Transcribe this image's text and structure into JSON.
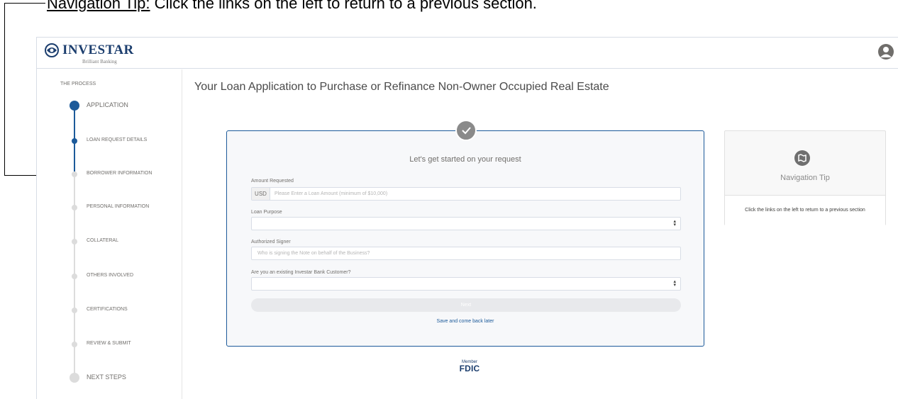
{
  "annotation": {
    "heading_underlined": "Navigation Tip:",
    "heading_rest": " Click the links on the left to return to a previous section."
  },
  "header": {
    "logo_text": "INVESTAR",
    "logo_subtitle": "Brilliant Banking",
    "brand_color": "#1c3e6e",
    "avatar_icon": "user-avatar-icon"
  },
  "sidebar": {
    "title": "THE PROCESS",
    "steps": [
      {
        "label": "APPLICATION",
        "state": "active",
        "size": "large"
      },
      {
        "label": "LOAN REQUEST DETAILS",
        "state": "active",
        "size": "small"
      },
      {
        "label": "BORROWER INFORMATION",
        "state": "pending",
        "size": "small"
      },
      {
        "label": "PERSONAL INFORMATION",
        "state": "pending",
        "size": "small"
      },
      {
        "label": "COLLATERAL",
        "state": "pending",
        "size": "small"
      },
      {
        "label": "OTHERS INVOLVED",
        "state": "pending",
        "size": "small"
      },
      {
        "label": "CERTIFICATIONS",
        "state": "pending",
        "size": "small"
      },
      {
        "label": "REVIEW & SUBMIT",
        "state": "pending",
        "size": "small"
      },
      {
        "label": "NEXT STEPS",
        "state": "pending",
        "size": "large"
      }
    ],
    "active_color": "#1c5a9a",
    "inactive_color": "#dcdcdc"
  },
  "main": {
    "page_title": "Your Loan Application to Purchase or Refinance Non-Owner Occupied Real Estate",
    "form": {
      "heading": "Let's get started on your request",
      "amount_label": "Amount Requested",
      "amount_currency": "USD",
      "amount_placeholder": "Please Enter a Loan Amount (minimum of $10,000)",
      "purpose_label": "Loan Purpose",
      "purpose_value": "",
      "signer_label": "Authorized Signer",
      "signer_placeholder": "Who is signing the Note on behalf of the Business?",
      "customer_label": "Are you an existing Investar Bank Customer?",
      "customer_value": "",
      "next_label": "Next",
      "save_link": "Save and come back later"
    },
    "fdic": {
      "member": "Member",
      "word": "FDIC"
    },
    "tip_card": {
      "title": "Navigation Tip",
      "body": "Click the links on the left to return to a previous section",
      "icon": "map-icon"
    }
  }
}
